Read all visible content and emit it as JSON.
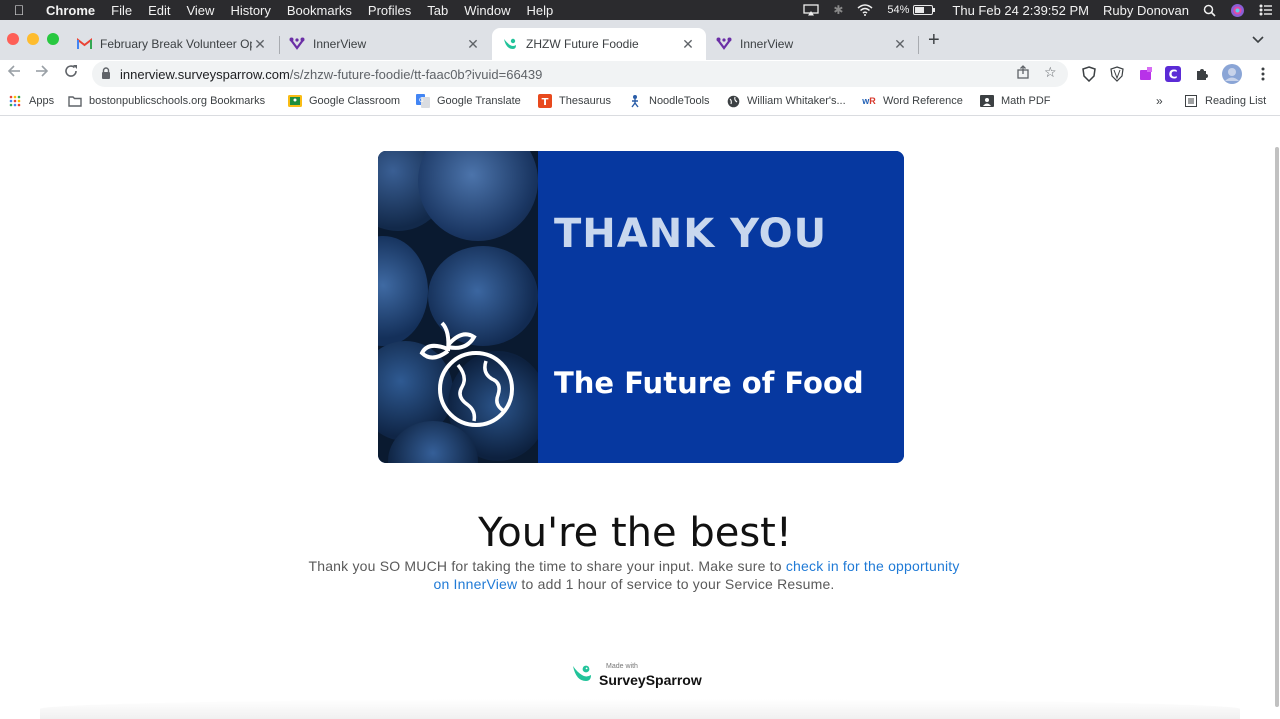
{
  "menubar": {
    "app": "Chrome",
    "items": [
      "File",
      "Edit",
      "View",
      "History",
      "Bookmarks",
      "Profiles",
      "Tab",
      "Window",
      "Help"
    ],
    "battery": "54%",
    "battery_level": 0.54,
    "datetime": "Thu Feb 24  2:39:52 PM",
    "user": "Ruby Donovan"
  },
  "tabs": [
    {
      "title": "February Break Volunteer Oppo",
      "icon": "gmail-icon",
      "active": false
    },
    {
      "title": "InnerView",
      "icon": "innerview-icon",
      "active": false
    },
    {
      "title": "ZHZW Future Foodie",
      "icon": "surveysparrow-icon",
      "active": true
    },
    {
      "title": "InnerView",
      "icon": "innerview-icon",
      "active": false
    }
  ],
  "url": {
    "host": "innerview.surveysparrow.com",
    "path": "/s/zhzw-future-foodie/tt-faac0b?ivuid=66439"
  },
  "bookmarks": {
    "items": [
      "Apps",
      "bostonpublicschools.org Bookmarks",
      "Google Classroom",
      "Google Translate",
      "Thesaurus",
      "NoodleTools",
      "William Whitaker's...",
      "Word Reference",
      "Math PDF"
    ],
    "overflow": "»",
    "reading_list": "Reading List"
  },
  "banner": {
    "heading": "THANK YOU",
    "subheading": "The Future of Food"
  },
  "content": {
    "headline": "You're the best!",
    "message_before": "Thank you SO MUCH for taking the time to share your input. Make sure to ",
    "message_link": "check in for the opportunity on InnerView",
    "message_after": " to add 1 hour of service to your Service Resume."
  },
  "footer": {
    "made_with": "Made with",
    "brand": "SurveySparrow"
  },
  "colors": {
    "banner_blue": "#0638a0",
    "link": "#1f7ad6",
    "sparrow_green": "#22c39a"
  }
}
